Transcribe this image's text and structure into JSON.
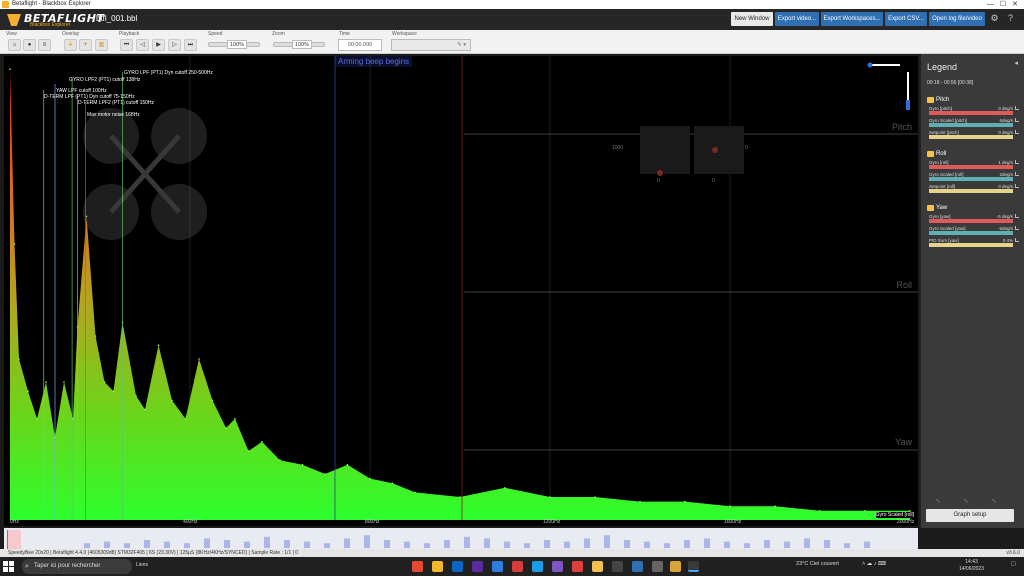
{
  "window": {
    "title": "Betaflight - Blackbox Explorer"
  },
  "header": {
    "logo_text": "BETAFLIGHT",
    "logo_sub": "Blackbox Explorer",
    "filename": "btfl_001.bbl",
    "buttons": [
      "New Window",
      "Export video...",
      "Export Workspaces...",
      "Export CSV...",
      "Open log file/video"
    ]
  },
  "toolbar": {
    "view_label": "View",
    "overlay_label": "Overlay",
    "playback_label": "Playback",
    "speed_label": "Speed",
    "speed_value": "100%",
    "zoom_label": "Zoom",
    "zoom_value": "100%",
    "time_label": "Time",
    "time_value": "00:00.000",
    "workspace_label": "Workspace"
  },
  "graph": {
    "arming_text": "Arming beep begins",
    "trace_labels": [
      "Pitch",
      "Roll",
      "Yaw"
    ],
    "markers": [
      {
        "label": "GYRO LPF (PT1) Dyn cutoff 250-500Hz",
        "freq": 250
      },
      {
        "label": "GYRO LPF2 (PT1) cutoff 138Hz",
        "freq": 138
      },
      {
        "label": "YAW LPF cutoff 100Hz",
        "freq": 100
      },
      {
        "label": "D-TERM LPF (PT1) Dyn cutoff 75-150Hz",
        "freq": 75
      },
      {
        "label": "D-TERM LPF2 (PT1) cutoff 150Hz",
        "freq": 150
      },
      {
        "label": "Max motor noise 168Hz",
        "freq": 168
      }
    ],
    "x_ticks": [
      "0Hz",
      "400Hz",
      "800Hz",
      "1200Hz",
      "1600Hz",
      "2000Hz"
    ],
    "scaled_label": "Gyro Scaled [roll]",
    "stick_values": {
      "left_value": "1000",
      "right_value": "0",
      "left_bottom": "0",
      "right_bottom": "0"
    }
  },
  "chart_data": {
    "type": "area",
    "title": "",
    "xlabel": "",
    "ylabel": "",
    "xlim": [
      0,
      2000
    ],
    "series": [
      {
        "name": "Gyro Scaled [roll]",
        "x": [
          0,
          10,
          20,
          40,
          60,
          80,
          100,
          120,
          140,
          150,
          170,
          190,
          210,
          230,
          250,
          280,
          300,
          330,
          360,
          390,
          420,
          450,
          480,
          500,
          530,
          560,
          600,
          650,
          700,
          750,
          800,
          850,
          900,
          1000,
          1100,
          1200,
          1300,
          1400,
          1500,
          1600,
          1700,
          1800,
          1900,
          2000
        ],
        "values": [
          0.98,
          0.6,
          0.35,
          0.28,
          0.22,
          0.3,
          0.18,
          0.3,
          0.22,
          0.42,
          0.66,
          0.4,
          0.3,
          0.28,
          0.43,
          0.27,
          0.24,
          0.38,
          0.26,
          0.22,
          0.35,
          0.26,
          0.2,
          0.22,
          0.15,
          0.17,
          0.13,
          0.12,
          0.1,
          0.12,
          0.09,
          0.08,
          0.06,
          0.05,
          0.07,
          0.05,
          0.05,
          0.04,
          0.04,
          0.03,
          0.03,
          0.02,
          0.02,
          0.02
        ]
      }
    ]
  },
  "legend": {
    "title": "Legend",
    "range": "00:18 - 00:56 [00:38]",
    "groups": [
      {
        "name": "Pitch",
        "items": [
          {
            "name": "Gyro [pitch]",
            "value": "0 deg/s",
            "color": "#e0595b"
          },
          {
            "name": "Gyro Scaled [pitch]",
            "value": "6deg/s",
            "color": "#5fb0b3"
          },
          {
            "name": "Setpoint [pitch]",
            "value": "0 deg/s",
            "color": "#e5d48a"
          }
        ]
      },
      {
        "name": "Roll",
        "items": [
          {
            "name": "Gyro [roll]",
            "value": "1 deg/s",
            "color": "#e0595b"
          },
          {
            "name": "Gyro Scaled [roll]",
            "value": "2deg/s",
            "color": "#5fb0b3"
          },
          {
            "name": "Setpoint [roll]",
            "value": "0 deg/s",
            "color": "#e5d48a"
          }
        ]
      },
      {
        "name": "Yaw",
        "items": [
          {
            "name": "Gyro [yaw]",
            "value": "-5 deg/s",
            "color": "#e0595b"
          },
          {
            "name": "Gyro Scaled [yaw]",
            "value": "-5deg/s",
            "color": "#5fb0b3"
          },
          {
            "name": "PID Sum [yaw]",
            "value": "0.4%",
            "color": "#e5d48a"
          }
        ]
      }
    ],
    "setup_button": "Graph setup"
  },
  "status": {
    "text": "SpeedyBee 20x20 | Betaflight 4.4.0 (4605309d8) STM32F405 | 6S (23.30V) | 125µS (8KHz/4KHz/SYNCED) | Sample Rate : 1/1 | 0",
    "version": "v3.6.0"
  },
  "taskbar": {
    "search_placeholder": "Taper ici pour rechercher",
    "weather_app": "Liens",
    "weather": "23°C  Ciel couvert",
    "time": "14:43",
    "date": "14/06/2023"
  }
}
